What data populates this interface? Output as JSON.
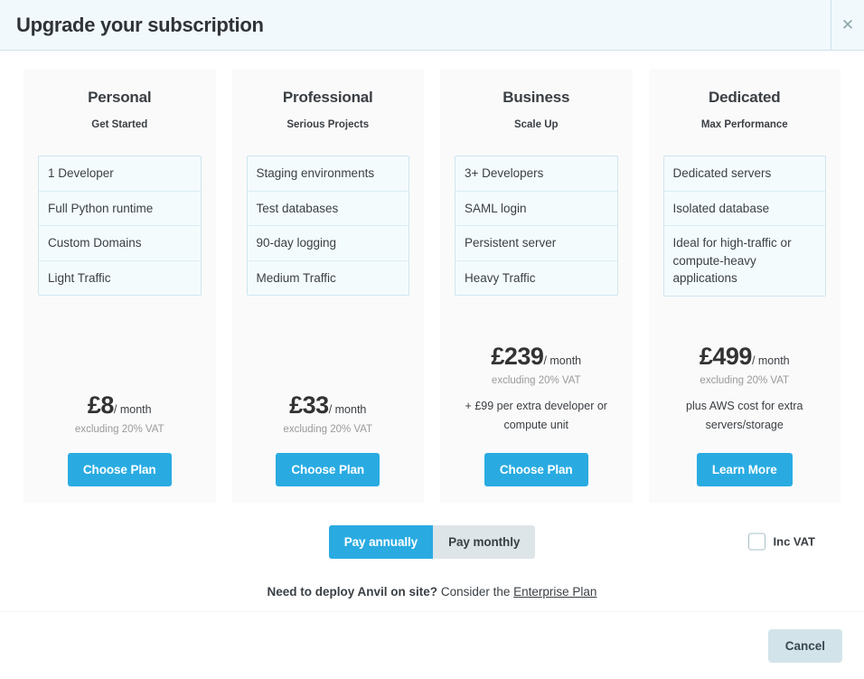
{
  "header": {
    "title": "Upgrade your subscription",
    "close_icon": "close-icon",
    "close_glyph": "✕"
  },
  "plans": [
    {
      "name": "Personal",
      "tagline": "Get Started",
      "features": [
        "1 Developer",
        "Full Python runtime",
        "Custom Domains",
        "Light Traffic"
      ],
      "price_amount": "£8",
      "price_period": "/ month",
      "price_vat": "excluding 20% VAT",
      "price_note": "",
      "button_label": "Choose Plan"
    },
    {
      "name": "Professional",
      "tagline": "Serious Projects",
      "features": [
        "Staging environments",
        "Test databases",
        "90-day logging",
        "Medium Traffic"
      ],
      "price_amount": "£33",
      "price_period": "/ month",
      "price_vat": "excluding 20% VAT",
      "price_note": "",
      "button_label": "Choose Plan"
    },
    {
      "name": "Business",
      "tagline": "Scale Up",
      "features": [
        "3+ Developers",
        "SAML login",
        "Persistent server",
        "Heavy Traffic"
      ],
      "price_amount": "£239",
      "price_period": "/ month",
      "price_vat": "excluding 20% VAT",
      "price_note": "+ £99 per extra developer or compute unit",
      "button_label": "Choose Plan"
    },
    {
      "name": "Dedicated",
      "tagline": "Max Performance",
      "features": [
        "Dedicated servers",
        "Isolated database",
        "Ideal for high-traffic or compute-heavy applications"
      ],
      "price_amount": "£499",
      "price_period": "/ month",
      "price_vat": "excluding 20% VAT",
      "price_note": "plus AWS cost for extra servers/storage",
      "button_label": "Learn More"
    }
  ],
  "billing": {
    "annual_label": "Pay annually",
    "monthly_label": "Pay monthly",
    "selected": "Pay annually"
  },
  "vat": {
    "label": "Inc VAT",
    "checked": false
  },
  "enterprise": {
    "prompt": "Need to deploy Anvil on site?",
    "middle": "Consider the",
    "link_label": "Enterprise Plan"
  },
  "footer": {
    "cancel_label": "Cancel"
  },
  "colors": {
    "accent_blue": "#29abe2",
    "header_bg": "#f2f9fc",
    "card_bg": "#fafafa",
    "feature_bg": "#f4fbfd",
    "feature_border": "#cfe6ef",
    "toggle_inactive": "#dde5e9",
    "cancel_bg": "#d3e3ea",
    "muted_text": "#9a9a9a"
  }
}
